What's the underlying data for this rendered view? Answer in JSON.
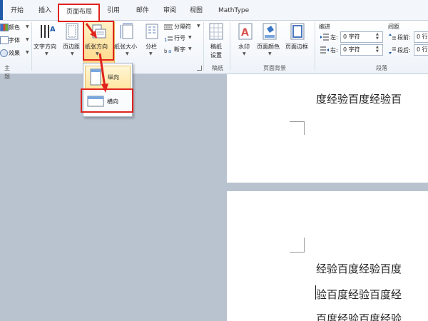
{
  "tabs": [
    "开始",
    "插入",
    "页面布局",
    "引用",
    "邮件",
    "审阅",
    "视图",
    "MathType"
  ],
  "active_tab": "页面布局",
  "theme_group": {
    "items": [
      "颜色",
      "字体",
      "效果"
    ],
    "label": "主题"
  },
  "page_setup_group": {
    "buttons": [
      "文字方向",
      "页边距",
      "纸张方向",
      "纸张大小",
      "分栏"
    ],
    "small_items": [
      "分隔符",
      "行号",
      "断字"
    ]
  },
  "manuscript_group": {
    "button_line1": "稿纸",
    "button_line2": "设置",
    "label": "稿纸"
  },
  "page_background_group": {
    "buttons": [
      "水印",
      "页面颜色",
      "页面边框"
    ],
    "label": "页面背景"
  },
  "paragraph_group": {
    "indent_label": "缩进",
    "spacing_label": "间距",
    "left_label": "左:",
    "right_label": "右:",
    "left_value": "0 字符",
    "right_value": "0 字符",
    "before_label": "段前:",
    "after_label": "段后:",
    "before_value": "0 行",
    "after_value": "0 行",
    "label": "段落"
  },
  "orientation_menu": {
    "portrait": "纵向",
    "landscape": "横向"
  },
  "document": {
    "page1_lines": [
      "度经验百度经验百"
    ],
    "page2_lines": [
      "经验百度经验百度",
      "验百度经验百度经",
      "百度经验百度经验"
    ]
  },
  "colors": {
    "annotation_red": "#e0231d",
    "active_tab_border": "#c6d1dd",
    "highlight": "#ffe6a0",
    "doc_background": "#b9c3cf"
  }
}
